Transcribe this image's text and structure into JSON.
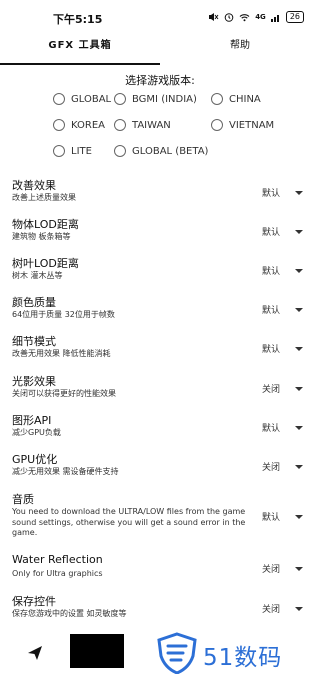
{
  "status": {
    "time": "下午5:15",
    "icons": [
      "mute-icon",
      "alarm-icon",
      "wifi-icon",
      "signal-icon"
    ],
    "network": "4G",
    "battery": "26"
  },
  "tabs": {
    "gfx": "GFX 工具箱",
    "help": "帮助"
  },
  "version": {
    "title": "选择游戏版本:",
    "options": [
      "GLOBAL",
      "BGMI (INDIA)",
      "CHINA",
      "KOREA",
      "TAIWAN",
      "VIETNAM",
      "LITE",
      "GLOBAL (BETA)"
    ]
  },
  "settings": [
    {
      "title": "改善效果",
      "desc": "改善上述质量效果",
      "value": "默认"
    },
    {
      "title": "物体LOD距离",
      "desc": "建筑物 板条箱等",
      "value": "默认"
    },
    {
      "title": "树叶LOD距离",
      "desc": "树木 灌木丛等",
      "value": "默认"
    },
    {
      "title": "颜色质量",
      "desc": "64位用于质量 32位用于帧数",
      "value": "默认"
    },
    {
      "title": "细节模式",
      "desc": "改善无用效果 降低性能消耗",
      "value": "默认"
    },
    {
      "title": "光影效果",
      "desc": "关闭可以获得更好的性能效果",
      "value": "关闭"
    },
    {
      "title": "图形API",
      "desc": "减少GPU负载",
      "value": "默认"
    },
    {
      "title": "GPU优化",
      "desc": "减少无用效果 需设备硬件支持",
      "value": "关闭"
    },
    {
      "title": "音质",
      "desc": "You need to download the ULTRA/LOW files from the game sound settings, otherwise you will get a sound error in the game.",
      "value": "默认"
    },
    {
      "title": "Water Reflection",
      "desc": "Only for Ultra graphics",
      "value": "关闭"
    },
    {
      "title": "保存控件",
      "desc": "保存您游戏中的设置 如灵敏度等",
      "value": "关闭"
    }
  ],
  "watermark": {
    "text": "51数码"
  },
  "colors": {
    "accent": "#2c6fd6",
    "text": "#111111"
  }
}
